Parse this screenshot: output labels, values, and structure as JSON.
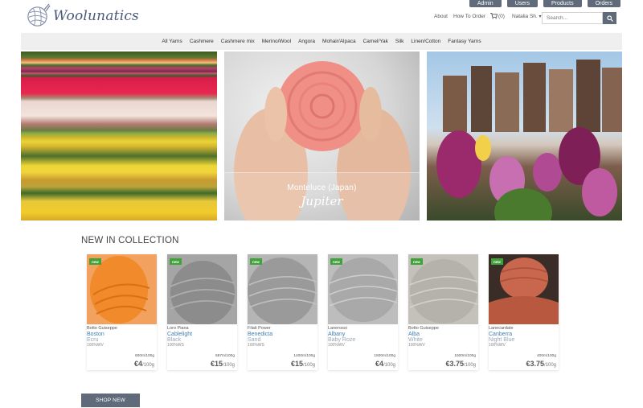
{
  "admin_bar": {
    "items": [
      {
        "label": "Admin"
      },
      {
        "label": "Users"
      },
      {
        "label": "Products"
      },
      {
        "label": "Orders"
      }
    ]
  },
  "header": {
    "logo_text": "Woolunatics",
    "nav": {
      "about": "About",
      "how_to_order": "How To Order"
    },
    "cart_count": "(0)",
    "user_name": "Natalia Sh.",
    "user_caret": "▾",
    "search_placeholder": "Search..."
  },
  "categories": [
    {
      "label": "All Yarns"
    },
    {
      "label": "Cashmere"
    },
    {
      "label": "Cashmere mix"
    },
    {
      "label": "Merino/Wool"
    },
    {
      "label": "Angora"
    },
    {
      "label": "Mohair/Alpaca"
    },
    {
      "label": "Camel/Yak"
    },
    {
      "label": "Silk"
    },
    {
      "label": "Linen/Cotton"
    },
    {
      "label": "Fantasy Yarns"
    }
  ],
  "banner": {
    "caption_sub": "Monteluce (Japan)",
    "caption_title": "Jupiter"
  },
  "section": {
    "title": "NEW IN COLLECTION"
  },
  "products": [
    {
      "badge": "new",
      "brand": "Botto Guiseppe",
      "name": "Boston",
      "color": "Ecru",
      "composition": "100%WV",
      "meterage": "600m/100g",
      "price": "€4",
      "unit": "/100g",
      "swatch": "#f08a2a"
    },
    {
      "badge": "new",
      "brand": "Loro Piana",
      "name": "Cablelight",
      "color": "Black",
      "composition": "100%WS",
      "meterage": "687m/100g",
      "price": "€15",
      "unit": "/100g",
      "swatch": "#8c8c8c"
    },
    {
      "badge": "new",
      "brand": "Filati Power",
      "name": "Benedicta",
      "color": "Sand",
      "composition": "100%WS",
      "meterage": "1400m/100g",
      "price": "€15",
      "unit": "/100g",
      "swatch": "#9a9a9a"
    },
    {
      "badge": "new",
      "brand": "Lanerossi",
      "name": "Albany",
      "color": "Baby Roze",
      "composition": "100%WV",
      "meterage": "1500m/100g",
      "price": "€4",
      "unit": "/100g",
      "swatch": "#a9a9a9"
    },
    {
      "badge": "new",
      "brand": "Botto Guiseppe",
      "name": "Alba",
      "color": "White",
      "composition": "100%WV",
      "meterage": "1500m/100g",
      "price": "€3.75",
      "unit": "/100g",
      "swatch": "#b5b2ac"
    },
    {
      "badge": "new",
      "brand": "Lanecardate",
      "name": "Canberra",
      "color": "Night Blue",
      "composition": "100%WV",
      "meterage": "400m/100g",
      "price": "€3.75",
      "unit": "/100g",
      "swatch": "#c8664e"
    }
  ],
  "shop_button": "SHOP NEW"
}
